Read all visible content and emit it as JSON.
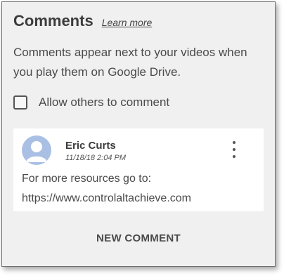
{
  "header": {
    "title": "Comments",
    "learn_more_label": "Learn more"
  },
  "description": "Comments appear next to your videos when you play them on Google Drive.",
  "allow_comments": {
    "label": "Allow others to comment",
    "checked": false
  },
  "comment": {
    "author": "Eric Curts",
    "timestamp": "11/18/18 2:04 PM",
    "body_line1": "For more resources go to:",
    "body_line2": "https://www.controlaltachieve.com",
    "avatar_icon": "user-avatar-icon",
    "menu_icon": "more-vert-icon"
  },
  "actions": {
    "new_comment_label": "NEW COMMENT"
  },
  "colors": {
    "panel_bg": "#f0f0f0",
    "card_bg": "#ffffff",
    "avatar_bg": "#a9c0e4",
    "text": "#4a4a4a"
  }
}
